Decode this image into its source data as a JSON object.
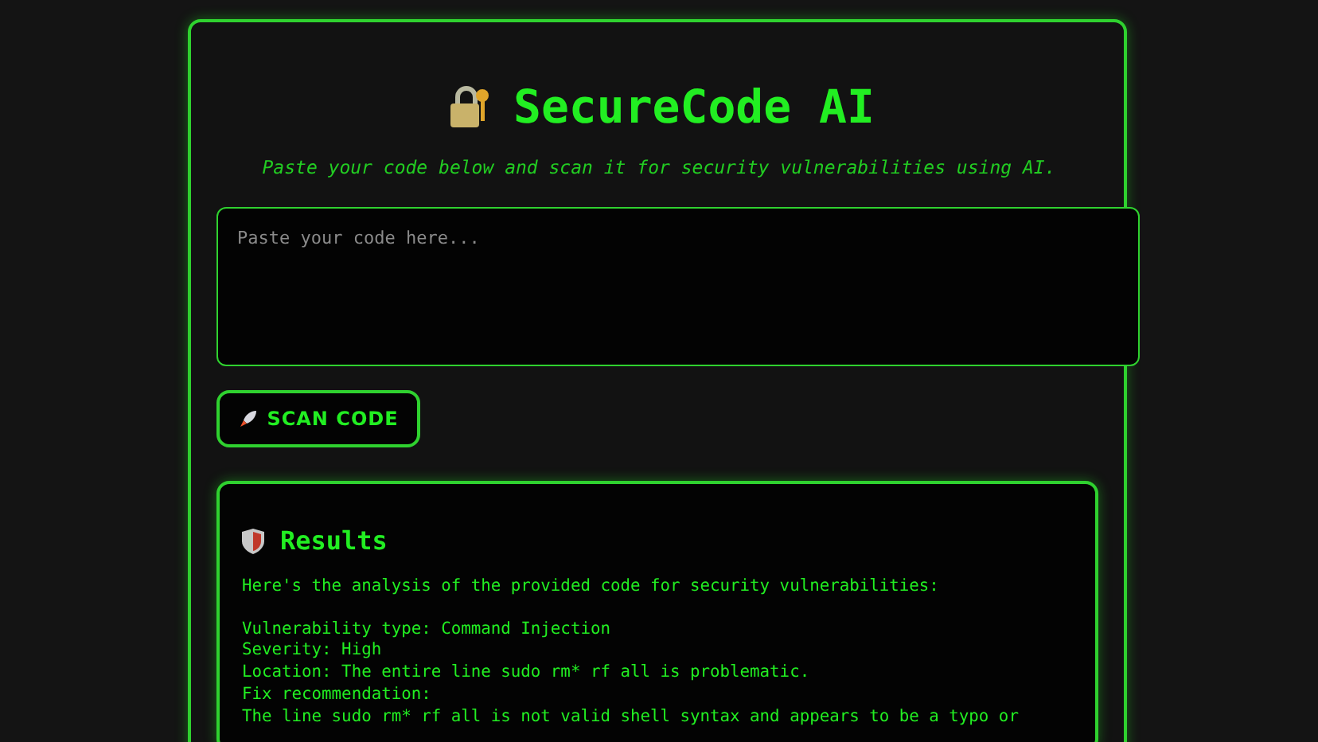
{
  "header": {
    "title": "SecureCode AI",
    "subtitle": "Paste your code below and scan it for security vulnerabilities using AI."
  },
  "code_input": {
    "placeholder": "Paste your code here..."
  },
  "scan_button": {
    "label": "SCAN CODE"
  },
  "results": {
    "title": "Results",
    "lines": [
      "Here's the analysis of the provided code for security vulnerabilities:"
    ],
    "details": [
      "Vulnerability type: Command Injection",
      "Severity: High",
      "Location: The entire line sudo rm* rf all is problematic.",
      "Fix recommendation:",
      "The line sudo rm* rf all is not valid shell syntax and appears to be a typo or"
    ]
  }
}
